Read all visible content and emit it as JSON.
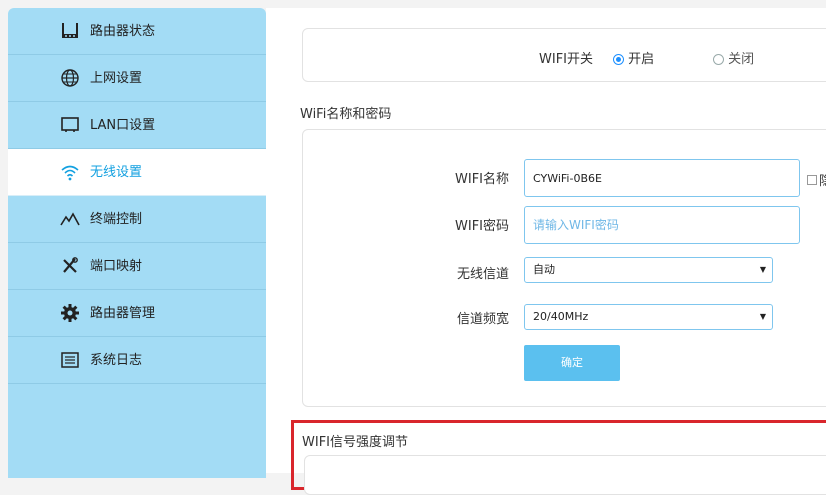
{
  "sidebar": {
    "items": [
      {
        "label": "路由器状态",
        "icon": "router-status-icon",
        "active": false
      },
      {
        "label": "上网设置",
        "icon": "globe-icon",
        "active": false
      },
      {
        "label": "LAN口设置",
        "icon": "monitor-icon",
        "active": false
      },
      {
        "label": "无线设置",
        "icon": "wifi-icon",
        "active": true
      },
      {
        "label": "终端控制",
        "icon": "terminal-wave-icon",
        "active": false
      },
      {
        "label": "端口映射",
        "icon": "tools-icon",
        "active": false
      },
      {
        "label": "路由器管理",
        "icon": "gear-icon",
        "active": false
      },
      {
        "label": "系统日志",
        "icon": "log-icon",
        "active": false
      }
    ]
  },
  "wifi_switch": {
    "label": "WIFI开关",
    "on_label": "开启",
    "off_label": "关闭",
    "selected": "on"
  },
  "wifi_section": {
    "title": "WiFi名称和密码",
    "name_label": "WIFI名称",
    "name_value": "CYWiFi-0B6E",
    "hide_label": "隐",
    "password_label": "WIFI密码",
    "password_placeholder": "请输入WIFI密码",
    "channel_label": "无线信道",
    "channel_value": "自动",
    "bandwidth_label": "信道频宽",
    "bandwidth_value": "20/40MHz",
    "confirm_label": "确定"
  },
  "signal_section": {
    "title": "WIFI信号强度调节"
  },
  "colors": {
    "sidebar_bg": "#a3dcf5",
    "active_text": "#12a0e0",
    "accent": "#5bc0ef",
    "highlight_border": "#d9262c"
  }
}
